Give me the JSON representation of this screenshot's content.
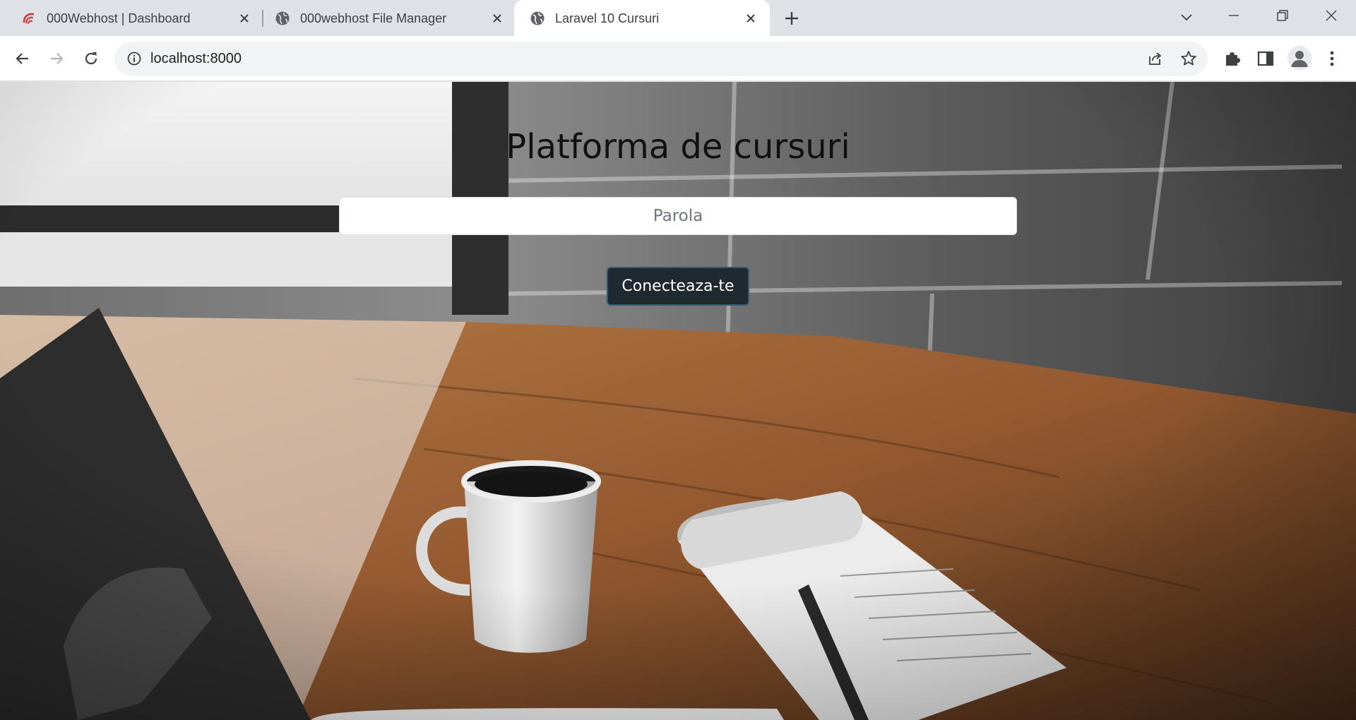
{
  "browser": {
    "tabs": [
      {
        "title": "000Webhost | Dashboard",
        "active": false
      },
      {
        "title": "000webhost File Manager",
        "active": false
      },
      {
        "title": "Laravel 10 Cursuri",
        "active": true
      }
    ],
    "address": "localhost:8000"
  },
  "page": {
    "heading": "Platforma de cursuri",
    "password_placeholder": "Parola",
    "login_label": "Conecteaza-te"
  },
  "icons": {
    "tab1_favicon": "000webhost-logo-icon",
    "tab_favicon": "globe-icon",
    "close": "close-icon",
    "new_tab": "plus-icon",
    "tab_search": "chevron-down-icon",
    "back": "arrow-left-icon",
    "forward": "arrow-right-icon",
    "reload": "reload-icon",
    "site_info": "info-icon",
    "share": "share-icon",
    "bookmark": "star-icon",
    "extensions": "puzzle-icon",
    "side_panel": "side-panel-icon",
    "profile": "avatar-icon",
    "menu": "kebab-menu-icon"
  },
  "colors": {
    "tabstrip": "#dee1e6",
    "button": "#1e2a30",
    "button_border": "#2a5d73"
  }
}
